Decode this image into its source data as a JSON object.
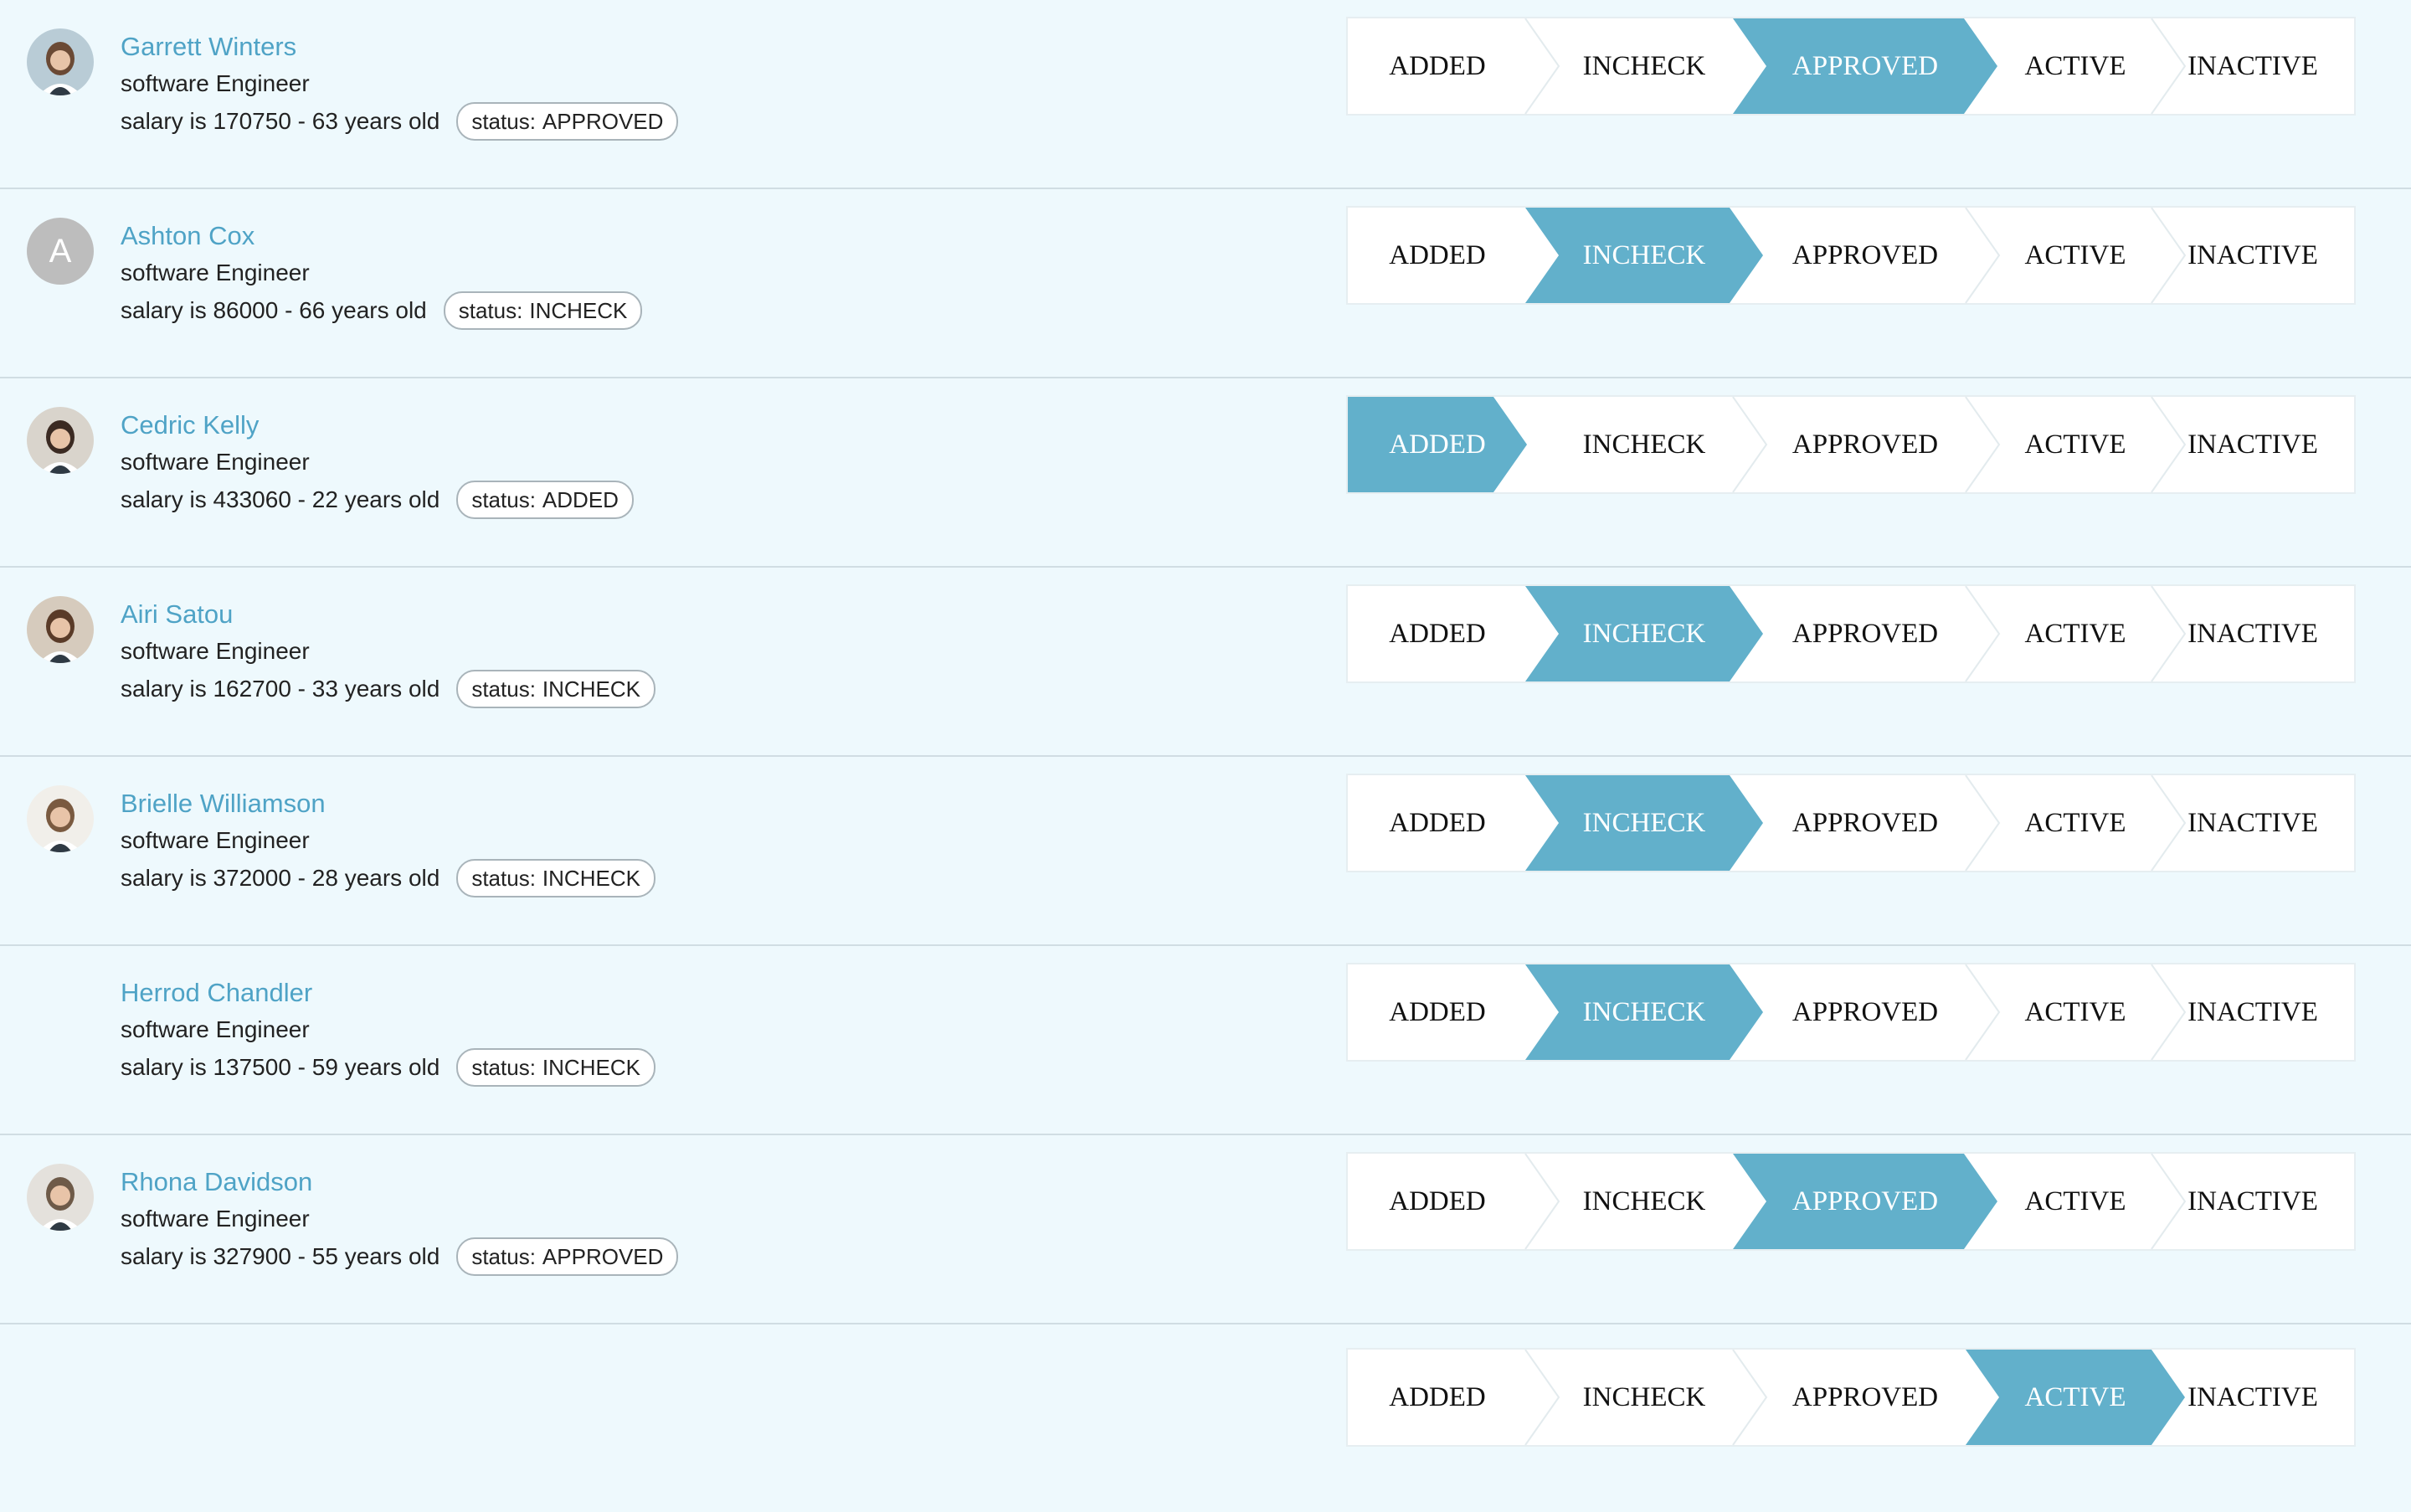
{
  "steps": [
    "ADDED",
    "INCHECK",
    "APPROVED",
    "ACTIVE",
    "INACTIVE"
  ],
  "status_prefix": "status:",
  "colors": {
    "accent": "#62b0cb",
    "name_link": "#4fa3c6",
    "background": "#eef9fd"
  },
  "employees": [
    {
      "name": "Garrett Winters",
      "role": "software Engineer",
      "salary_text": "salary is 170750 - 63 years old",
      "status": "APPROVED",
      "current_step": 2,
      "avatar": {
        "type": "photo",
        "icon": "person-photo-icon",
        "hair": "#6b4a35",
        "bg": "#b9ccd6"
      }
    },
    {
      "name": "Ashton Cox",
      "role": "software Engineer",
      "salary_text": "salary is 86000 - 66 years old",
      "status": "INCHECK",
      "current_step": 1,
      "avatar": {
        "type": "initial",
        "initial": "A"
      }
    },
    {
      "name": "Cedric Kelly",
      "role": "software Engineer",
      "salary_text": "salary is 433060 - 22 years old",
      "status": "ADDED",
      "current_step": 0,
      "avatar": {
        "type": "photo",
        "icon": "person-photo-icon",
        "hair": "#3b2a22",
        "bg": "#d9d4cc"
      }
    },
    {
      "name": "Airi Satou",
      "role": "software Engineer",
      "salary_text": "salary is 162700 - 33 years old",
      "status": "INCHECK",
      "current_step": 1,
      "avatar": {
        "type": "photo",
        "icon": "person-photo-icon",
        "hair": "#5a3b28",
        "bg": "#d6cbbd"
      }
    },
    {
      "name": "Brielle Williamson",
      "role": "software Engineer",
      "salary_text": "salary is 372000 - 28 years old",
      "status": "INCHECK",
      "current_step": 1,
      "avatar": {
        "type": "photo",
        "icon": "person-photo-icon",
        "hair": "#7a5a40",
        "bg": "#f1efea"
      }
    },
    {
      "name": "Herrod Chandler",
      "role": "software Engineer",
      "salary_text": "salary is 137500 - 59 years old",
      "status": "INCHECK",
      "current_step": 1,
      "avatar": {
        "type": "blank"
      }
    },
    {
      "name": "Rhona Davidson",
      "role": "software Engineer",
      "salary_text": "salary is 327900 - 55 years old",
      "status": "APPROVED",
      "current_step": 2,
      "avatar": {
        "type": "photo",
        "icon": "person-photo-icon",
        "hair": "#6e5a48",
        "bg": "#e4e1dc"
      }
    },
    {
      "partial": true,
      "current_step": 3
    }
  ]
}
